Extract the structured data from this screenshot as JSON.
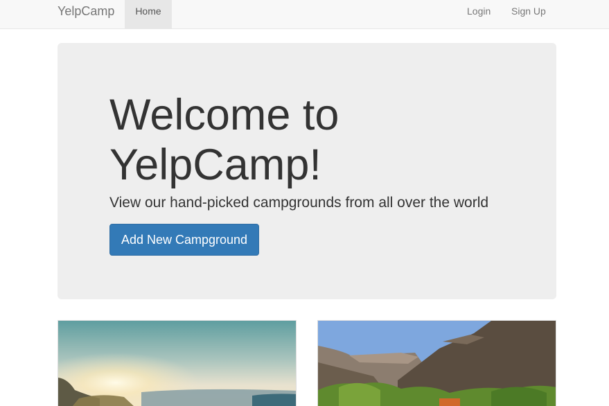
{
  "navbar": {
    "brand": "YelpCamp",
    "home": "Home",
    "login": "Login",
    "signup": "Sign Up"
  },
  "jumbotron": {
    "title": "Welcome to YelpCamp!",
    "subtitle": "View our hand-picked campgrounds from all over the world",
    "add_button": "Add New Campground"
  },
  "campgrounds": [
    {
      "image": "campground-sunset-photo"
    },
    {
      "image": "campground-canyon-photo"
    }
  ],
  "colors": {
    "primary": "#337ab7",
    "jumbotron_bg": "#eeeeee",
    "navbar_bg": "#f8f8f8"
  }
}
